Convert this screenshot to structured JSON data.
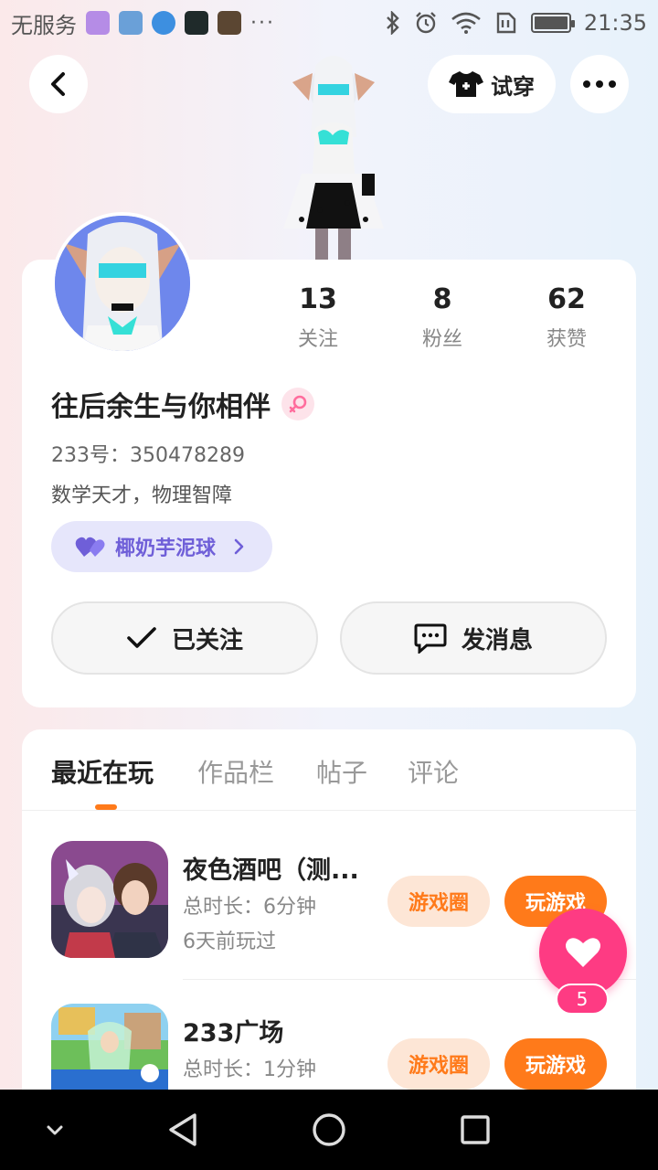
{
  "status_bar": {
    "carrier": "无服务",
    "more_dots": "···",
    "time": "21:35",
    "battery_level": 0.9
  },
  "header": {
    "tryon_label": "试穿"
  },
  "profile": {
    "stats": [
      {
        "value": "13",
        "label": "关注"
      },
      {
        "value": "8",
        "label": "粉丝"
      },
      {
        "value": "62",
        "label": "获赞"
      }
    ],
    "nickname": "往后余生与你相伴",
    "gender": "female",
    "uid": "233号：350478289",
    "bio": "数学天才，物理智障",
    "tag_label": "椰奶芋泥球",
    "followed_label": "已关注",
    "message_label": "发消息"
  },
  "tabs": [
    {
      "label": "最近在玩",
      "active": true
    },
    {
      "label": "作品栏",
      "active": false
    },
    {
      "label": "帖子",
      "active": false
    },
    {
      "label": "评论",
      "active": false
    }
  ],
  "games": [
    {
      "title": "夜色酒吧（测...",
      "duration": "总时长：6分钟",
      "last_played": "6天前玩过",
      "circle_label": "游戏圈",
      "play_label": "玩游戏"
    },
    {
      "title": "233广场",
      "duration": "总时长：1分钟",
      "circle_label": "游戏圈",
      "play_label": "玩游戏"
    }
  ],
  "like": {
    "count": "5"
  },
  "colors": {
    "accent_orange": "#ff7a1a",
    "like_pink": "#fe3b83",
    "tag_purple": "#6f5fd8"
  }
}
